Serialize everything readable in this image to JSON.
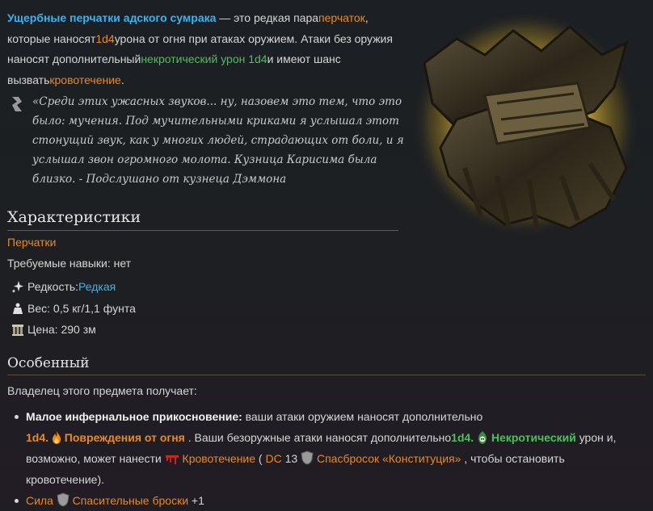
{
  "intro": {
    "item_name": "Ущербные перчатки адского сумрака",
    "t1": " — это редкая пара",
    "link_gloves": "перчаток",
    "t2": ", которые наносят",
    "dice1": "1d4",
    "t3": "урона от огня при атаках оружием. Атаки без оружия наносят дополнительный",
    "necrotic_dmg": "некротический урон 1d4",
    "t4": "и имеют шанс вызвать",
    "link_bleeding": "кровотечение",
    "t5": "."
  },
  "quote": "«Среди этих ужасных звуков... ну, назовем это тем, что это было: мучения. Под мучительными криками я услышал этот стонущий звук, как у многих людей, страдающих от боли, и я услышал звон огромного молота. Кузница Карисима была близко. - Подслушано от кузнеца Дэммона",
  "stats": {
    "heading": "Характеристики",
    "type": "Перчатки",
    "skills": "Требуемые навыки: нет",
    "rarity_label": "Редкость: ",
    "rarity_value": "Редкая",
    "weight": "Вес: 0,5 кг/1,1 фунта",
    "price": "Цена: 290 зм"
  },
  "special": {
    "heading": "Особенный",
    "owner_text": "Владелец этого предмета получает:",
    "item1": {
      "title": "Малое инфернальное прикосновение:",
      "t1": " ваши атаки оружием наносят дополнительно",
      "dice1": "1d4.",
      "fire_dmg": "Повреждения от огня",
      "t2": " . Ваши безоружные атаки наносят дополнительно",
      "dice2": "1d4.",
      "necrotic": "Некротический",
      "t3": " урон и, возможно, может нанести ",
      "bleeding": "Кровотечение",
      "t4": " ( ",
      "dc": "DC",
      "dc_value": " 13 ",
      "save": "Спасбросок «Конституция»",
      "t5": " , чтобы остановить кровотечение)."
    },
    "item2": {
      "strength": "Сила",
      "saves": "Спасительные броски",
      "bonus": " +1"
    }
  },
  "colors": {
    "accent_orange": "#e58a2b",
    "accent_green": "#4ec05a",
    "accent_blue": "#3fb2ee"
  }
}
